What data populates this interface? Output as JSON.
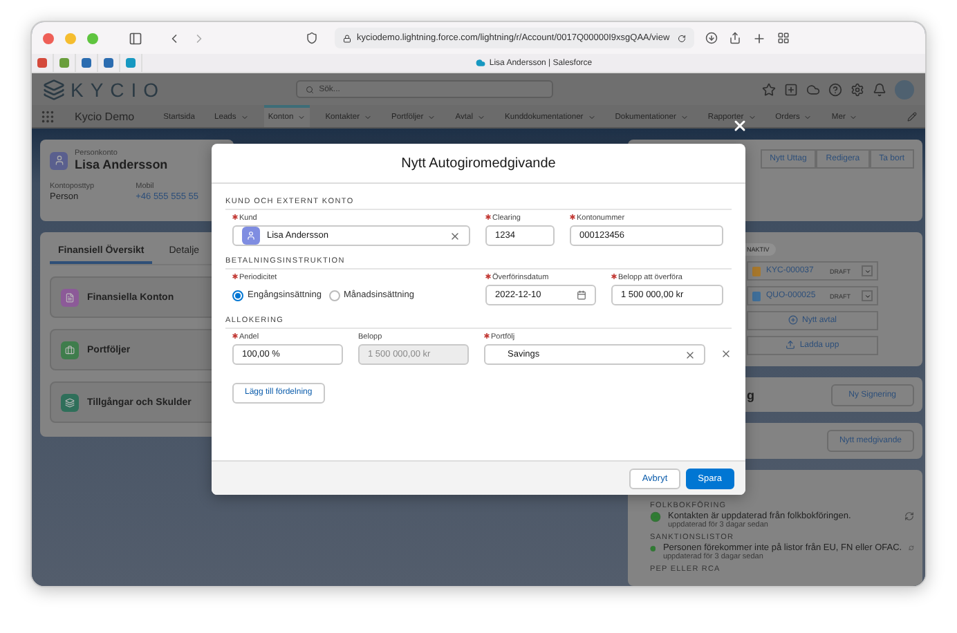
{
  "browser": {
    "url": "kyciodemo.lightning.force.com/lightning/r/Account/0017Q00000I9xsgQAA/view",
    "tab_title": "Lisa Andersson | Salesforce"
  },
  "header": {
    "logo": "KYCIO",
    "search_placeholder": "Sök..."
  },
  "nav": {
    "app_name": "Kycio Demo",
    "items": [
      {
        "label": "Startsida",
        "selected": false,
        "dropdown": false
      },
      {
        "label": "Leads",
        "selected": false,
        "dropdown": true
      },
      {
        "label": "Konton",
        "selected": true,
        "dropdown": true
      },
      {
        "label": "Kontakter",
        "selected": false,
        "dropdown": true
      },
      {
        "label": "Portföljer",
        "selected": false,
        "dropdown": true
      },
      {
        "label": "Avtal",
        "selected": false,
        "dropdown": true
      },
      {
        "label": "Kunddokumentationer",
        "selected": false,
        "dropdown": true
      },
      {
        "label": "Dokumentationer",
        "selected": false,
        "dropdown": true
      },
      {
        "label": "Rapporter",
        "selected": false,
        "dropdown": true
      },
      {
        "label": "Orders",
        "selected": false,
        "dropdown": true
      },
      {
        "label": "Mer",
        "selected": false,
        "dropdown": true
      }
    ]
  },
  "record": {
    "type": "Personkonto",
    "name": "Lisa Andersson",
    "fields": [
      {
        "label": "Kontoposttyp",
        "value": "Person",
        "kind": "text"
      },
      {
        "label": "Mobil",
        "value": "+46 555 555 55",
        "kind": "link"
      }
    ]
  },
  "tabs": [
    {
      "label": "Finansiell Översikt",
      "selected": true
    },
    {
      "label": "Detalje",
      "selected": false
    }
  ],
  "related": [
    {
      "title": "Finansiella Konton",
      "color": "#8c5a98"
    },
    {
      "title": "Portföljer",
      "color": "#3f7d4c"
    },
    {
      "title": "Tillgångar och Skulder",
      "color": "#2f6f5a"
    }
  ],
  "actions": [
    "Nytt Uttag",
    "Redigera",
    "Ta bort"
  ],
  "agreements": {
    "chip": "NAKTIV",
    "items": [
      {
        "number": "KYC-000037",
        "status": "DRAFT",
        "color": "#a8782c"
      },
      {
        "number": "QUO-000025",
        "status": "DRAFT",
        "color": "#3f6f9a"
      }
    ],
    "buttons": [
      "Nytt avtal",
      "Ladda upp"
    ]
  },
  "signing": {
    "heading": "g",
    "button": "Ny Signering"
  },
  "mandate": {
    "button": "Nytt medgivande"
  },
  "checks": [
    {
      "heading": "FOLKBOKFÖRING",
      "text": "Kontakten är uppdaterad från folkbokföringen.",
      "updated": "uppdaterad för 3 dagar sedan",
      "ok": true
    },
    {
      "heading": "SANKTIONSLISTOR",
      "text": "Personen förekommer inte på listor från EU, FN eller OFAC.",
      "updated": "uppdaterad för 3 dagar sedan",
      "ok": true
    }
  ],
  "checks_cut_heading": "PEP ELLER RCA",
  "modal": {
    "title": "Nytt Autogiromedgivande",
    "sections": [
      {
        "title": "KUND OCH EXTERNT KONTO",
        "fields": [
          {
            "kind": "lookup",
            "label": "Kund",
            "required": true,
            "value": "Lisa Andersson"
          },
          {
            "kind": "text",
            "label": "Clearing",
            "required": true,
            "value": "1234"
          },
          {
            "kind": "text",
            "label": "Kontonummer",
            "required": true,
            "value": "000123456"
          }
        ]
      },
      {
        "title": "BETALNINGSINSTRUKTION",
        "fields": [
          {
            "kind": "radio",
            "label": "Periodicitet",
            "required": true,
            "options": [
              {
                "label": "Engångsinsättning",
                "selected": true
              },
              {
                "label": "Månadsinsättning",
                "selected": false
              }
            ]
          },
          {
            "kind": "date",
            "label": "Överförinsdatum",
            "required": true,
            "value": "2022-12-10"
          },
          {
            "kind": "text",
            "label": "Belopp att överföra",
            "required": true,
            "value": "1 500 000,00 kr"
          }
        ]
      },
      {
        "title": "ALLOKERING",
        "fields": [
          {
            "kind": "text",
            "label": "Andel",
            "required": true,
            "value": "100,00 %"
          },
          {
            "kind": "text",
            "label": "Belopp",
            "required": false,
            "value": "1 500 000,00 kr",
            "disabled": true
          },
          {
            "kind": "select",
            "label": "Portfölj",
            "required": true,
            "value": "Savings"
          }
        ],
        "add_button": "Lägg till fördelning"
      }
    ],
    "buttons": [
      {
        "label": "Avbryt",
        "kind": "neutral"
      },
      {
        "label": "Spara",
        "kind": "brand"
      }
    ]
  }
}
